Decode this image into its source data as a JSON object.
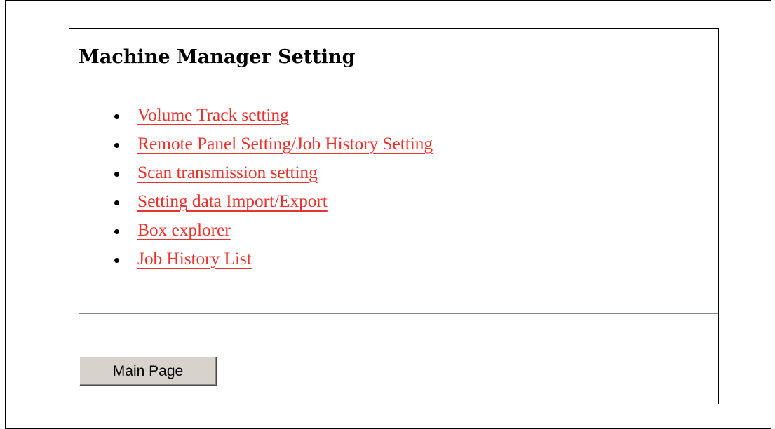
{
  "page": {
    "title": "Machine Manager Setting"
  },
  "menu": {
    "items": [
      {
        "label": "Volume Track setting"
      },
      {
        "label": "Remote Panel Setting/Job History Setting"
      },
      {
        "label": "Scan transmission setting"
      },
      {
        "label": "Setting data Import/Export"
      },
      {
        "label": "Box explorer"
      },
      {
        "label": "Job History List"
      }
    ]
  },
  "footer": {
    "main_page_label": "Main Page"
  },
  "colors": {
    "link": "#e8342f",
    "divider": "#7a8a8a",
    "button_face": "#d6d3cd"
  }
}
